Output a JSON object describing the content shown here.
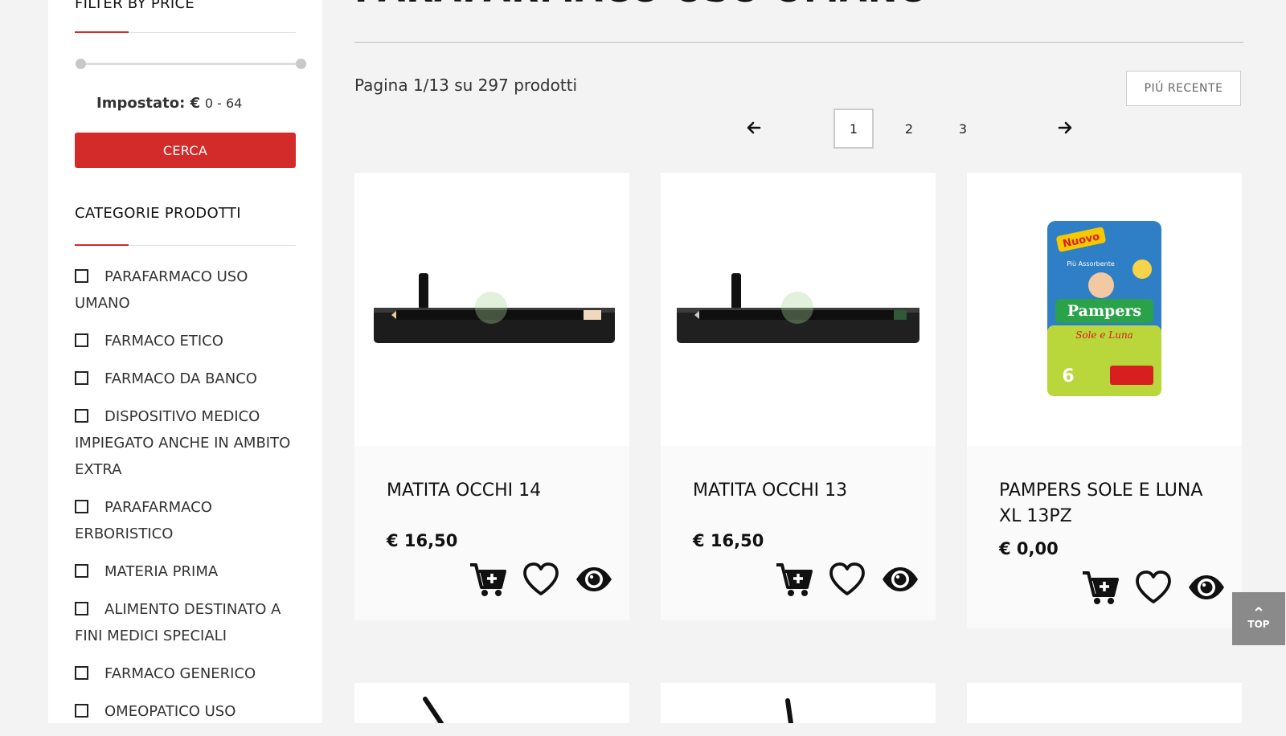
{
  "sidebar": {
    "price_filter": {
      "heading": "FILTER BY PRICE",
      "set_label": "Impostato: €",
      "range": "0 - 64",
      "min_fraction": 0.0,
      "max_fraction": 1.0,
      "search_label": "CERCA"
    },
    "categories": {
      "heading": "CATEGORIE PRODOTTI",
      "items": [
        {
          "label": "PARAFARMACO USO UMANO"
        },
        {
          "label": "FARMACO ETICO"
        },
        {
          "label": "FARMACO DA BANCO"
        },
        {
          "label": "DISPOSITIVO MEDICO IMPIEGATO ANCHE IN AMBITO EXTRA"
        },
        {
          "label": "PARAFARMACO ERBORISTICO"
        },
        {
          "label": "MATERIA PRIMA"
        },
        {
          "label": "ALIMENTO DESTINATO A FINI MEDICI SPECIALI"
        },
        {
          "label": "FARMACO GENERICO"
        },
        {
          "label": "OMEOPATICO USO"
        }
      ]
    }
  },
  "main": {
    "title": "PARAFARMACO USO UMANO",
    "results_text": "Pagina 1/13 su 297 prodotti",
    "sort_label": "PIÚ RECENTE",
    "pagination": {
      "prev_icon": "arrow-left-icon",
      "pages": [
        "1",
        "2",
        "3"
      ],
      "current": "1",
      "next_icon": "arrow-right-icon"
    },
    "products": [
      {
        "name": "MATITA OCCHI 14",
        "price": "€ 16,50",
        "image": "eye-pencil-black"
      },
      {
        "name": "MATITA OCCHI 13",
        "price": "€ 16,50",
        "image": "eye-pencil-black"
      },
      {
        "name": "PAMPERS SOLE E LUNA XL 13PZ",
        "price": "€ 0,00",
        "image": "diaper-pack"
      }
    ],
    "actions": {
      "cart_icon": "add-to-cart-icon",
      "wishlist_icon": "heart-icon",
      "view_icon": "eye-icon"
    },
    "pampers_pack": {
      "badge": "Nuovo",
      "sub": "Più Assorbente",
      "brand": "Pampers",
      "line": "Sole e Luna",
      "size": "6"
    }
  },
  "top_button": {
    "label": "TOP",
    "icon": "chevron-up-icon"
  },
  "colors": {
    "accent": "#d32a2a",
    "background": "#f3f3f3",
    "top_button": "#8a8a8a"
  }
}
